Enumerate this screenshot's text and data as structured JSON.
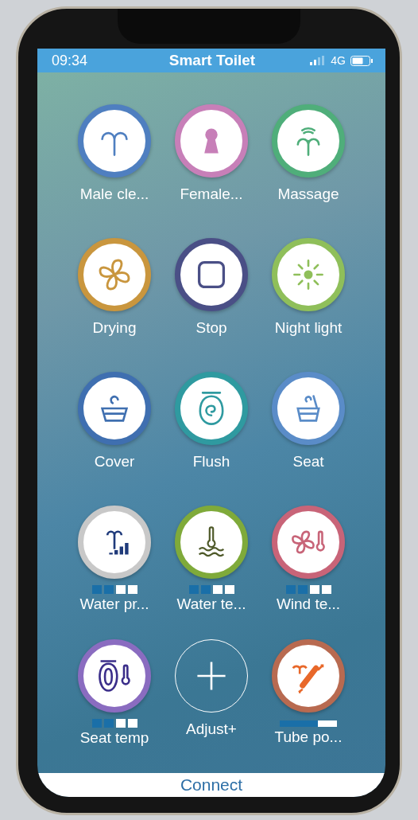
{
  "status_bar": {
    "time": "09:34",
    "title": "Smart Toilet",
    "network": "4G"
  },
  "items": [
    {
      "label": "Male cle...",
      "kind": "toggle",
      "color": "#4f7fc0"
    },
    {
      "label": "Female...",
      "kind": "toggle",
      "color": "#c77fb8"
    },
    {
      "label": "Massage",
      "kind": "toggle",
      "color": "#4fae7a"
    },
    {
      "label": "Drying",
      "kind": "toggle",
      "color": "#c9963e"
    },
    {
      "label": "Stop",
      "kind": "toggle",
      "color": "#4a4f86"
    },
    {
      "label": "Night light",
      "kind": "toggle",
      "color": "#8fbf5a"
    },
    {
      "label": "Cover",
      "kind": "toggle",
      "color": "#3f6fb0"
    },
    {
      "label": "Flush",
      "kind": "toggle",
      "color": "#2f9aa0"
    },
    {
      "label": "Seat",
      "kind": "toggle",
      "color": "#5a8cc8"
    },
    {
      "label": "Water pr...",
      "kind": "adjust",
      "color": "#c8c8c8",
      "level": 0.5
    },
    {
      "label": "Water te...",
      "kind": "adjust",
      "color": "#7faa3a",
      "level": 0.5
    },
    {
      "label": "Wind te...",
      "kind": "adjust",
      "color": "#c86478",
      "level": 0.5
    },
    {
      "label": "Seat temp",
      "kind": "adjust",
      "color": "#8a6cc0",
      "level": 0.5
    },
    {
      "label": "Adjust+",
      "kind": "add",
      "color": "#ffffff"
    },
    {
      "label": "Tube po...",
      "kind": "bar",
      "color": "#b86a50",
      "level": 0.67
    }
  ],
  "footer": {
    "button": "Connect"
  }
}
